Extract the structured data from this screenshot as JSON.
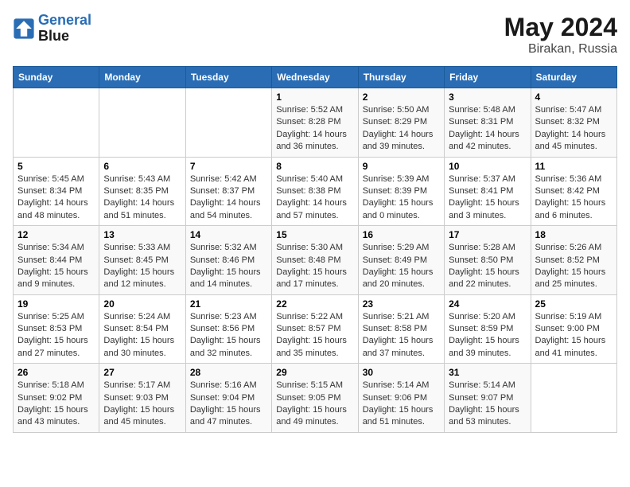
{
  "header": {
    "logo_line1": "General",
    "logo_line2": "Blue",
    "month": "May 2024",
    "location": "Birakan, Russia"
  },
  "days_of_week": [
    "Sunday",
    "Monday",
    "Tuesday",
    "Wednesday",
    "Thursday",
    "Friday",
    "Saturday"
  ],
  "weeks": [
    [
      {
        "day": "",
        "info": ""
      },
      {
        "day": "",
        "info": ""
      },
      {
        "day": "",
        "info": ""
      },
      {
        "day": "1",
        "info": "Sunrise: 5:52 AM\nSunset: 8:28 PM\nDaylight: 14 hours\nand 36 minutes."
      },
      {
        "day": "2",
        "info": "Sunrise: 5:50 AM\nSunset: 8:29 PM\nDaylight: 14 hours\nand 39 minutes."
      },
      {
        "day": "3",
        "info": "Sunrise: 5:48 AM\nSunset: 8:31 PM\nDaylight: 14 hours\nand 42 minutes."
      },
      {
        "day": "4",
        "info": "Sunrise: 5:47 AM\nSunset: 8:32 PM\nDaylight: 14 hours\nand 45 minutes."
      }
    ],
    [
      {
        "day": "5",
        "info": "Sunrise: 5:45 AM\nSunset: 8:34 PM\nDaylight: 14 hours\nand 48 minutes."
      },
      {
        "day": "6",
        "info": "Sunrise: 5:43 AM\nSunset: 8:35 PM\nDaylight: 14 hours\nand 51 minutes."
      },
      {
        "day": "7",
        "info": "Sunrise: 5:42 AM\nSunset: 8:37 PM\nDaylight: 14 hours\nand 54 minutes."
      },
      {
        "day": "8",
        "info": "Sunrise: 5:40 AM\nSunset: 8:38 PM\nDaylight: 14 hours\nand 57 minutes."
      },
      {
        "day": "9",
        "info": "Sunrise: 5:39 AM\nSunset: 8:39 PM\nDaylight: 15 hours\nand 0 minutes."
      },
      {
        "day": "10",
        "info": "Sunrise: 5:37 AM\nSunset: 8:41 PM\nDaylight: 15 hours\nand 3 minutes."
      },
      {
        "day": "11",
        "info": "Sunrise: 5:36 AM\nSunset: 8:42 PM\nDaylight: 15 hours\nand 6 minutes."
      }
    ],
    [
      {
        "day": "12",
        "info": "Sunrise: 5:34 AM\nSunset: 8:44 PM\nDaylight: 15 hours\nand 9 minutes."
      },
      {
        "day": "13",
        "info": "Sunrise: 5:33 AM\nSunset: 8:45 PM\nDaylight: 15 hours\nand 12 minutes."
      },
      {
        "day": "14",
        "info": "Sunrise: 5:32 AM\nSunset: 8:46 PM\nDaylight: 15 hours\nand 14 minutes."
      },
      {
        "day": "15",
        "info": "Sunrise: 5:30 AM\nSunset: 8:48 PM\nDaylight: 15 hours\nand 17 minutes."
      },
      {
        "day": "16",
        "info": "Sunrise: 5:29 AM\nSunset: 8:49 PM\nDaylight: 15 hours\nand 20 minutes."
      },
      {
        "day": "17",
        "info": "Sunrise: 5:28 AM\nSunset: 8:50 PM\nDaylight: 15 hours\nand 22 minutes."
      },
      {
        "day": "18",
        "info": "Sunrise: 5:26 AM\nSunset: 8:52 PM\nDaylight: 15 hours\nand 25 minutes."
      }
    ],
    [
      {
        "day": "19",
        "info": "Sunrise: 5:25 AM\nSunset: 8:53 PM\nDaylight: 15 hours\nand 27 minutes."
      },
      {
        "day": "20",
        "info": "Sunrise: 5:24 AM\nSunset: 8:54 PM\nDaylight: 15 hours\nand 30 minutes."
      },
      {
        "day": "21",
        "info": "Sunrise: 5:23 AM\nSunset: 8:56 PM\nDaylight: 15 hours\nand 32 minutes."
      },
      {
        "day": "22",
        "info": "Sunrise: 5:22 AM\nSunset: 8:57 PM\nDaylight: 15 hours\nand 35 minutes."
      },
      {
        "day": "23",
        "info": "Sunrise: 5:21 AM\nSunset: 8:58 PM\nDaylight: 15 hours\nand 37 minutes."
      },
      {
        "day": "24",
        "info": "Sunrise: 5:20 AM\nSunset: 8:59 PM\nDaylight: 15 hours\nand 39 minutes."
      },
      {
        "day": "25",
        "info": "Sunrise: 5:19 AM\nSunset: 9:00 PM\nDaylight: 15 hours\nand 41 minutes."
      }
    ],
    [
      {
        "day": "26",
        "info": "Sunrise: 5:18 AM\nSunset: 9:02 PM\nDaylight: 15 hours\nand 43 minutes."
      },
      {
        "day": "27",
        "info": "Sunrise: 5:17 AM\nSunset: 9:03 PM\nDaylight: 15 hours\nand 45 minutes."
      },
      {
        "day": "28",
        "info": "Sunrise: 5:16 AM\nSunset: 9:04 PM\nDaylight: 15 hours\nand 47 minutes."
      },
      {
        "day": "29",
        "info": "Sunrise: 5:15 AM\nSunset: 9:05 PM\nDaylight: 15 hours\nand 49 minutes."
      },
      {
        "day": "30",
        "info": "Sunrise: 5:14 AM\nSunset: 9:06 PM\nDaylight: 15 hours\nand 51 minutes."
      },
      {
        "day": "31",
        "info": "Sunrise: 5:14 AM\nSunset: 9:07 PM\nDaylight: 15 hours\nand 53 minutes."
      },
      {
        "day": "",
        "info": ""
      }
    ]
  ]
}
